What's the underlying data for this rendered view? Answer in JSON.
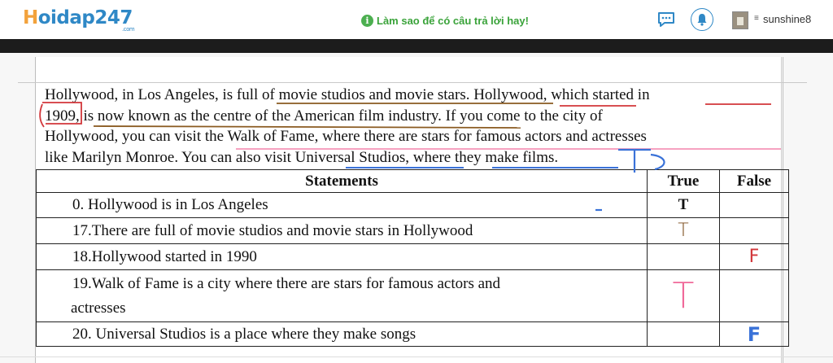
{
  "header": {
    "logo_first": "H",
    "logo_rest": "oidap247",
    "logo_suffix": ".com",
    "tip": "Làm sao để có câu trả lời hay!",
    "username": "sunshine8"
  },
  "passage": {
    "lines": [
      "Hollywood, in Los Angeles, is full of movie studios and movie stars. Hollywood, which started in",
      "1909, is now known as the centre of the American film industry. If you come to the city of",
      "Hollywood, you can visit the Walk of Fame, where there are stars for famous actors and actresses",
      "like Marilyn  Monroe. You can also visit Universal  Studios, where they make films."
    ]
  },
  "table": {
    "headers": [
      "Statements",
      "True",
      "False"
    ],
    "rows": [
      {
        "statement": "0.   Hollywood is in Los Angeles",
        "true": "T",
        "false": ""
      },
      {
        "statement": "17.There are full of movie studios and movie stars in Hollywood",
        "true": "T",
        "false": ""
      },
      {
        "statement": "18.Hollywood started in 1990",
        "true": "",
        "false": "F"
      },
      {
        "statement_line1": "19.Walk  of  Fame  is  a  city  where  there  are  stars  for  famous  actors  and",
        "statement_line2": "actresses",
        "true": "T",
        "false": ""
      },
      {
        "statement": "20. Universal Studios is a place  where they make songs",
        "true": "",
        "false": "F"
      }
    ]
  },
  "colors": {
    "logo_orange": "#f2a23c",
    "logo_blue": "#2f88c6",
    "tip_green": "#3aa33a",
    "ink_red": "#d2363a",
    "ink_blue": "#3a72d8",
    "ink_brown": "#8a5a20",
    "ink_pink": "#f06a9a"
  },
  "icons": [
    "info-icon",
    "chat-icon",
    "bell-icon",
    "avatar",
    "chevron-down-icon"
  ]
}
